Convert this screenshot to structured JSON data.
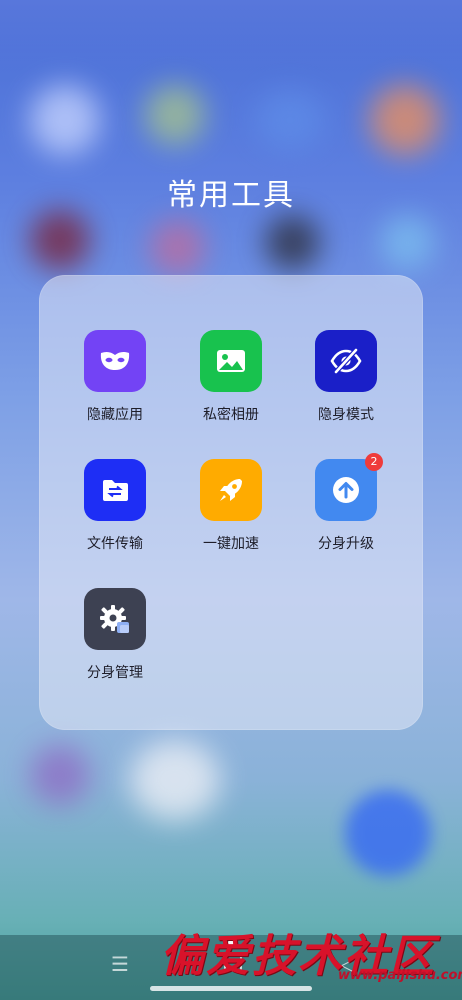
{
  "folder": {
    "title": "常用工具",
    "apps": [
      {
        "label": "隐藏应用",
        "icon": "mask-icon",
        "color": "#7343f5"
      },
      {
        "label": "私密相册",
        "icon": "image-icon",
        "color": "#18c24e"
      },
      {
        "label": "隐身模式",
        "icon": "eye-off-icon",
        "color": "#1a1fc8"
      },
      {
        "label": "文件传输",
        "icon": "folder-transfer-icon",
        "color": "#1e2ef5"
      },
      {
        "label": "一键加速",
        "icon": "rocket-icon",
        "color": "#ffab00"
      },
      {
        "label": "分身升级",
        "icon": "arrow-up-circle-icon",
        "color": "#4289f0",
        "badge": "2"
      },
      {
        "label": "分身管理",
        "icon": "gear-icon",
        "color": "#3d4152"
      }
    ]
  },
  "navbar": {
    "menu_icon": "☰",
    "back_icon": "◁"
  },
  "watermark": {
    "text": "偏爱技术社区",
    "url": "www.paijishu.com"
  }
}
